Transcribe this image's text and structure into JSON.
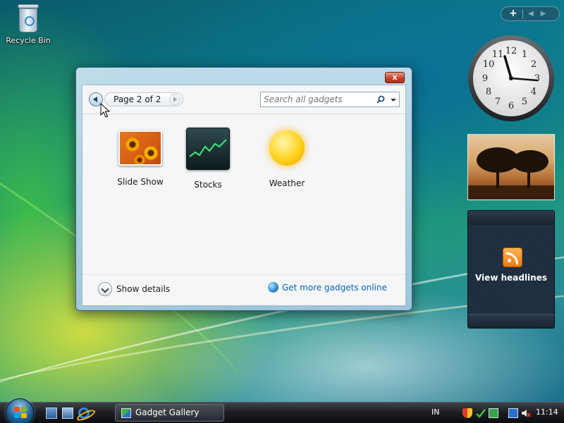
{
  "desktop": {
    "recycle_bin_label": "Recycle Bin"
  },
  "gallery": {
    "close_label": "x",
    "page_label": "Page 2 of 2",
    "search_placeholder": "Search all gadgets",
    "gadgets": [
      {
        "label": "Slide Show",
        "icon": "slideshow-thumbnail"
      },
      {
        "label": "Stocks",
        "icon": "stocks-thumbnail"
      },
      {
        "label": "Weather",
        "icon": "weather-sun"
      }
    ],
    "show_details_label": "Show details",
    "get_more_label": "Get more gadgets online"
  },
  "sidebar": {
    "add_label": "+",
    "prev_label": "◀",
    "next_label": "▶",
    "clock_numbers": [
      "12",
      "1",
      "2",
      "3",
      "4",
      "5",
      "6",
      "7",
      "8",
      "9",
      "10",
      "11"
    ],
    "feed_label": "View headlines"
  },
  "taskbar": {
    "task_label": "Gadget Gallery",
    "language": "IN",
    "time": "11:14"
  },
  "colors": {
    "link": "#0d64b8",
    "close": "#c7442a",
    "rss": "#f27a0c",
    "accent": "#1e5d93"
  }
}
